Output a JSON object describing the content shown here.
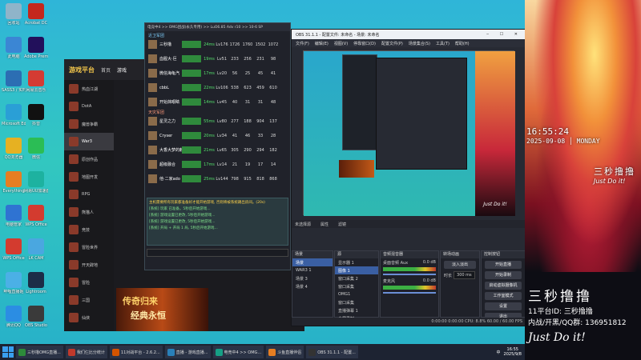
{
  "desktop_icons": [
    {
      "label": "回收站",
      "color": "#8fb4c9"
    },
    {
      "label": "此电脑",
      "color": "#3b86d4"
    },
    {
      "label": "SASS3 / 实时",
      "color": "#2c6eb3"
    },
    {
      "label": "Microsoft Edge",
      "color": "#2a9fd6"
    },
    {
      "label": "QQ浏览器",
      "color": "#e6b122"
    },
    {
      "label": "Everything",
      "color": "#e67e22"
    },
    {
      "label": "电脑管家",
      "color": "#2f73d2"
    },
    {
      "label": "WPS Office",
      "color": "#d33b2f"
    },
    {
      "label": "哔哩直播姬",
      "color": "#4bb0e6"
    },
    {
      "label": "腾讯QQ",
      "color": "#2b8de3"
    },
    {
      "label": "Acrobat DC",
      "color": "#c4271d"
    },
    {
      "label": "Adobe Premiere",
      "color": "#22105b"
    },
    {
      "label": "网易云音乐",
      "color": "#d43b33"
    },
    {
      "label": "抖音",
      "color": "#111111"
    },
    {
      "label": "微信",
      "color": "#2bbd55"
    },
    {
      "label": "网易UU加速器",
      "color": "#1db2a0"
    },
    {
      "label": "WPS Office",
      "color": "#d33b2f"
    },
    {
      "label": "LK CAM",
      "color": "#4aa7e0"
    },
    {
      "label": "Lightroom",
      "color": "#1c2d47"
    },
    {
      "label": "OBS Studio",
      "color": "#3a3a3a"
    }
  ],
  "launcher": {
    "logo": "游戏平台",
    "tabs": [
      "首页",
      "游戏"
    ],
    "side_items": [
      "热血江湖",
      "DotA",
      "魔兽争霸",
      "War3",
      "原创作品",
      "地图开发",
      "RPG",
      "熊猫人",
      "竞技",
      "冒险世界",
      "开天辟地",
      "冒险",
      "三国",
      "仙侠"
    ],
    "active_index": 3,
    "banner": {
      "line1": "传奇归来",
      "line2": "经典永恒"
    }
  },
  "players": {
    "title": "电竞中4 >> OMG团战(永久专用) >> LuO6.85 Adv r10 >> 10-6 SP",
    "team1_label": "近卫军团",
    "team2_label": "天灾军团",
    "header": [
      "玩家",
      "状态",
      "Ping",
      "积分",
      "场次",
      "胜率",
      "MVP",
      "逃跑"
    ],
    "team1": [
      {
        "name": "三秒撸",
        "status": "24ms",
        "lv": "Lv176",
        "a": "1726",
        "b": "1760",
        "c": "1502",
        "d": "1072"
      },
      {
        "name": "血腥大·巨",
        "status": "19ms",
        "lv": "Lv51",
        "a": "233",
        "b": "256",
        "c": "231",
        "d": "98"
      },
      {
        "name": "微信海龟汽",
        "status": "17ms",
        "lv": "Lv20",
        "a": "56",
        "b": "25",
        "c": "45",
        "d": "41"
      },
      {
        "name": "cbbL",
        "status": "22ms",
        "lv": "Lv106",
        "a": "538",
        "b": "623",
        "c": "459",
        "d": "610"
      },
      {
        "name": "开始抹眼睛",
        "status": "14ms",
        "lv": "Lv45",
        "a": "40",
        "b": "31",
        "c": "31",
        "d": "48"
      }
    ],
    "team2": [
      {
        "name": "星灵之力",
        "status": "55ms",
        "lv": "Lv80",
        "a": "277",
        "b": "188",
        "c": "904",
        "d": "137"
      },
      {
        "name": "Cryser",
        "status": "20ms",
        "lv": "Lv34",
        "a": "41",
        "b": "46",
        "c": "33",
        "d": "28"
      },
      {
        "name": "大香大梦的麒",
        "status": "21ms",
        "lv": "Lv65",
        "a": "305",
        "b": "290",
        "c": "294",
        "d": "182"
      },
      {
        "name": "超级融合",
        "status": "17ms",
        "lv": "Lv14",
        "a": "21",
        "b": "19",
        "c": "17",
        "d": "14"
      },
      {
        "name": "他·二家ado",
        "status": "25ms",
        "lv": "Lv144",
        "a": "798",
        "b": "915",
        "c": "818",
        "d": "868"
      }
    ],
    "chat": [
      "主机需要所有玩家都准备好才能开始游戏, 否则将被系统踢出房间。(20s)",
      "[系统] 玩家 已准备。5秒后开始游戏...",
      "[系统] 游戏设置已更改, 5秒后开始游戏...",
      "[系统] 游戏设置已更改, 5秒后开始游戏...",
      "[系统] 开局 + 开局 1 局, 5秒后开始游戏..."
    ]
  },
  "obs": {
    "title": "OBS 31.1.1 - 配置文件: 未命名 - 场景: 未命名",
    "menu": [
      "文件(F)",
      "编辑(E)",
      "视图(V)",
      "停靠窗口(D)",
      "配置文件(P)",
      "场景集合(S)",
      "工具(T)",
      "帮助(H)"
    ],
    "source_bar": [
      "未选择源",
      "属性",
      "滤镜"
    ],
    "docks": {
      "scenes": {
        "title": "场景",
        "items": [
          "场景",
          "WAR3 1",
          "场景 3",
          "场景 4"
        ],
        "selected": 0
      },
      "sources": {
        "title": "源",
        "items": [
          "显示器 1",
          "图像 1",
          "窗口采集 2",
          "窗口采集",
          "OMG1",
          "窗口采集",
          "直播弹幕 1",
          "全屏录制"
        ],
        "selected": 1
      },
      "mixer": {
        "title": "音频混音器",
        "tracks": [
          {
            "name": "桌面音频 Aux",
            "db": "0.0 dB"
          },
          {
            "name": "麦克风",
            "db": "0.0 dB"
          }
        ]
      },
      "transitions": {
        "title": "转场动画",
        "type": "淡入淡出",
        "duration_label": "时长",
        "duration": "300 ms"
      },
      "controls": {
        "title": "控制按钮",
        "buttons": [
          "开始直播",
          "开始录制",
          "启动虚拟摄像机",
          "工作室模式",
          "设置",
          "退出"
        ]
      }
    },
    "status": "0:00:00  0:00:00  CPU: 8.8%  60.00 / 60.00 FPS"
  },
  "stream": {
    "time": "16:55:24",
    "date": "2025-09-08",
    "weekday": "MONDAY",
    "streamer_name": "三秒撸撸",
    "signature": "Just Do it!",
    "platform_line": "11平台ID: 三秒撸撸",
    "contact_line": "内战/开黑/QQ群: 136951812"
  },
  "taskbar": {
    "items": [
      {
        "label": "三秒撸OMG直播...",
        "color": "#2d8b3a"
      },
      {
        "label": "我们仨比分统计",
        "color": "#c0392b"
      },
      {
        "label": "11对战平台 - 2.6.2...",
        "color": "#d35400"
      },
      {
        "label": "直播 - 游戏直播...",
        "color": "#2980b9"
      },
      {
        "label": "电竞中4 >> OMG...",
        "color": "#16a085"
      },
      {
        "label": "斗鱼直播伴侣",
        "color": "#e67e22"
      },
      {
        "label": "OBS 31.1.1 - 配置...",
        "color": "#333333"
      }
    ],
    "tray": "中",
    "clock_time": "16:55",
    "clock_date": "2025/9/8"
  }
}
